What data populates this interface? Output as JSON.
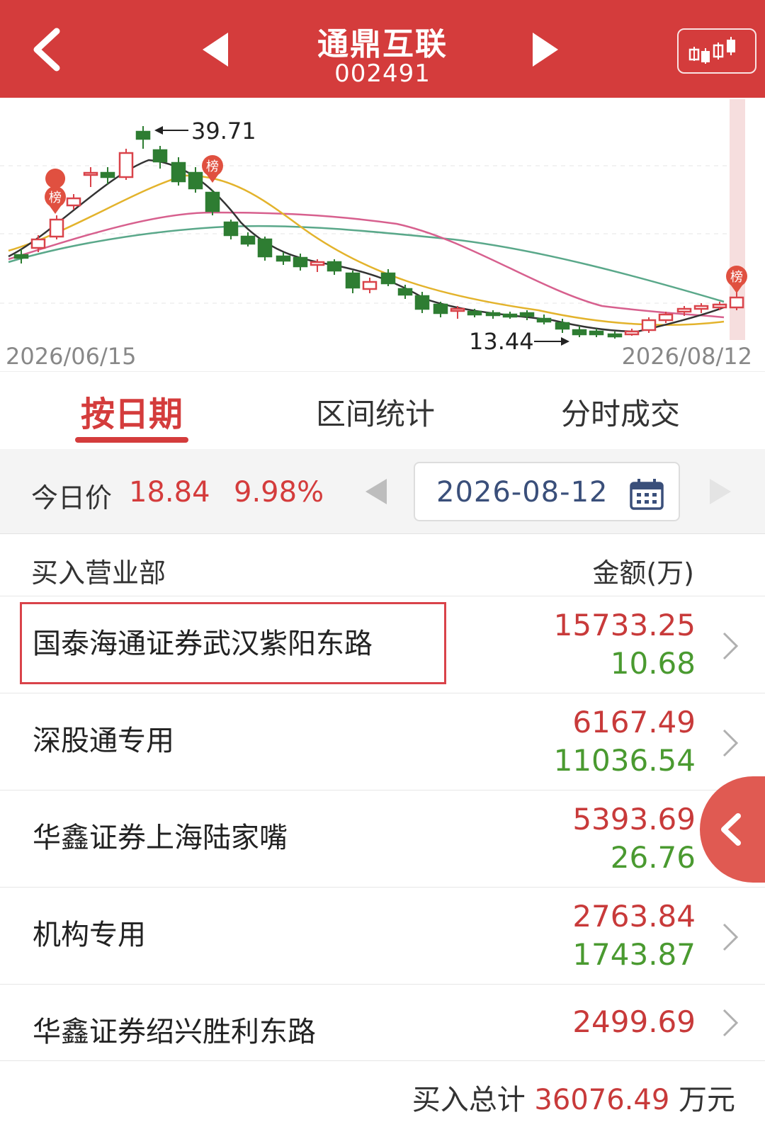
{
  "header": {
    "title": "通鼎互联",
    "code": "002491"
  },
  "chart": {
    "start_date": "2026/06/15",
    "end_date": "2026/08/12",
    "high_label": "39.71",
    "low_label": "13.44",
    "badge_label": "榜"
  },
  "tabs": [
    {
      "label": "按日期"
    },
    {
      "label": "区间统计"
    },
    {
      "label": "分时成交"
    }
  ],
  "price": {
    "label": "今日价",
    "value": "18.84",
    "change": "9.98%"
  },
  "date_picker": {
    "value": "2026-08-12"
  },
  "list_header": {
    "left": "买入营业部",
    "right": "金额(万)"
  },
  "rows": [
    {
      "name": "国泰海通证券武汉紫阳东路",
      "buy": "15733.25",
      "sell": "10.68"
    },
    {
      "name": "深股通专用",
      "buy": "6167.49",
      "sell": "11036.54"
    },
    {
      "name": "华鑫证券上海陆家嘴",
      "buy": "5393.69",
      "sell": "26.76"
    },
    {
      "name": "机构专用",
      "buy": "2763.84",
      "sell": "1743.87"
    },
    {
      "name": "华鑫证券绍兴胜利东路",
      "buy": "2499.69",
      "sell": ""
    }
  ],
  "footer": {
    "prefix": "买入总计",
    "total": "36076.49",
    "unit": "万元"
  },
  "colors": {
    "brand_red": "#d43c3c",
    "up_red": "#c83a3a",
    "down_green": "#4a9a30"
  }
}
